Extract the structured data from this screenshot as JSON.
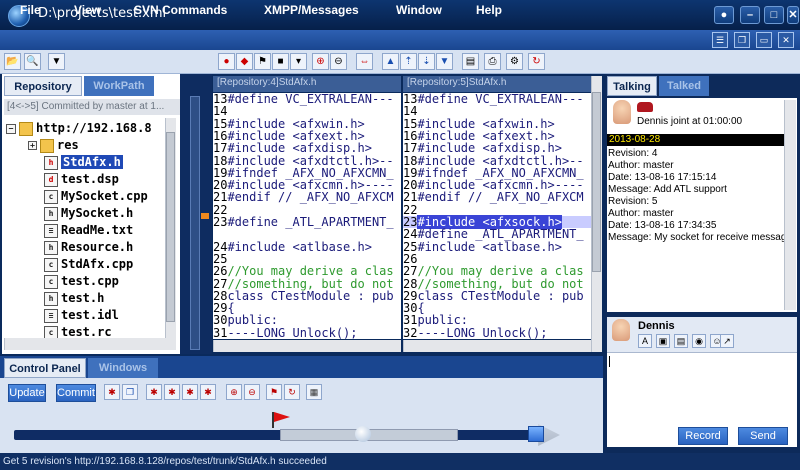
{
  "window": {
    "title": "D:\\projects\\test.xml",
    "minimize": "–",
    "maximize": "□",
    "close": "✕"
  },
  "menu": [
    "File",
    "View",
    "SVN Commands",
    "XMPP/Messages",
    "Window",
    "Help"
  ],
  "left_tabs": {
    "repository": "Repository",
    "workpath": "WorkPath"
  },
  "commit_info": "[4<->5] Committed by master at 1...",
  "tree": {
    "root": "http://192.168.8",
    "items": [
      "res",
      "StdAfx.h",
      "test.dsp",
      "MySocket.cpp",
      "MySocket.h",
      "ReadMe.txt",
      "Resource.h",
      "StdAfx.cpp",
      "test.cpp",
      "test.h",
      "test.idl",
      "test.rc"
    ]
  },
  "diff": {
    "left_header": "[Repository:4]StdAfx.h",
    "right_header": "[Repository:5]StdAfx.h",
    "left_lines": [
      [
        "13",
        "#define VC_EXTRALEAN---"
      ],
      [
        "14",
        ""
      ],
      [
        "15",
        "#include <afxwin.h>"
      ],
      [
        "16",
        "#include <afxext.h>"
      ],
      [
        "17",
        "#include <afxdisp.h>"
      ],
      [
        "18",
        "#include <afxdtctl.h>--"
      ],
      [
        "19",
        "#ifndef _AFX_NO_AFXCMN_"
      ],
      [
        "20",
        "#include <afxcmn.h>----"
      ],
      [
        "21",
        "#endif // _AFX_NO_AFXCM"
      ],
      [
        "22",
        ""
      ],
      [
        "23",
        "#define _ATL_APARTMENT_"
      ],
      [
        "",
        ""
      ],
      [
        "24",
        "#include <atlbase.h>"
      ],
      [
        "25",
        ""
      ],
      [
        "26",
        "//You may derive a clas"
      ],
      [
        "27",
        "//something, but do not"
      ],
      [
        "28",
        "class CTestModule : pub"
      ],
      [
        "29",
        "{"
      ],
      [
        "30",
        "public:"
      ],
      [
        "31",
        "----LONG Unlock();"
      ]
    ],
    "right_lines": [
      [
        "13",
        "#define VC_EXTRALEAN---"
      ],
      [
        "14",
        ""
      ],
      [
        "15",
        "#include <afxwin.h>"
      ],
      [
        "16",
        "#include <afxext.h>"
      ],
      [
        "17",
        "#include <afxdisp.h>"
      ],
      [
        "18",
        "#include <afxdtctl.h>--"
      ],
      [
        "19",
        "#ifndef _AFX_NO_AFXCMN_"
      ],
      [
        "20",
        "#include <afxcmn.h>----"
      ],
      [
        "21",
        "#endif // _AFX_NO_AFXCM"
      ],
      [
        "22",
        ""
      ],
      [
        "23",
        "#include <afxsock.h>"
      ],
      [
        "24",
        "#define _ATL_APARTMENT_"
      ],
      [
        "25",
        "#include <atlbase.h>"
      ],
      [
        "26",
        ""
      ],
      [
        "27",
        "//You may derive a clas"
      ],
      [
        "28",
        "//something, but do not"
      ],
      [
        "29",
        "class CTestModule : pub"
      ],
      [
        "30",
        "{"
      ],
      [
        "31",
        "public:"
      ],
      [
        "32",
        "----LONG Unlock();"
      ]
    ]
  },
  "chat": {
    "tabs": {
      "talking": "Talking",
      "talked": "Talked"
    },
    "joined": "Dennis joint at 01:00:00",
    "date": "2013-08-28",
    "log": [
      "Revision: 4",
      "Author: master",
      "Date: 13-08-16 17:15:14",
      "Message: Add ATL support",
      "Revision: 5",
      "Author: master",
      "Date: 13-08-16 17:34:35",
      "Message: My socket for receive message"
    ],
    "contact": "Dennis",
    "record_label": "Record",
    "send_label": "Send"
  },
  "control_panel": {
    "tab": "Control Panel",
    "windows_tab": "Windows",
    "update_label": "Update",
    "commit_label": "Commit",
    "timeline_position": 0.57
  },
  "status": "Get 5 revision's http://192.168.8.128/repos/test/trunk/StdAfx.h succeeded"
}
